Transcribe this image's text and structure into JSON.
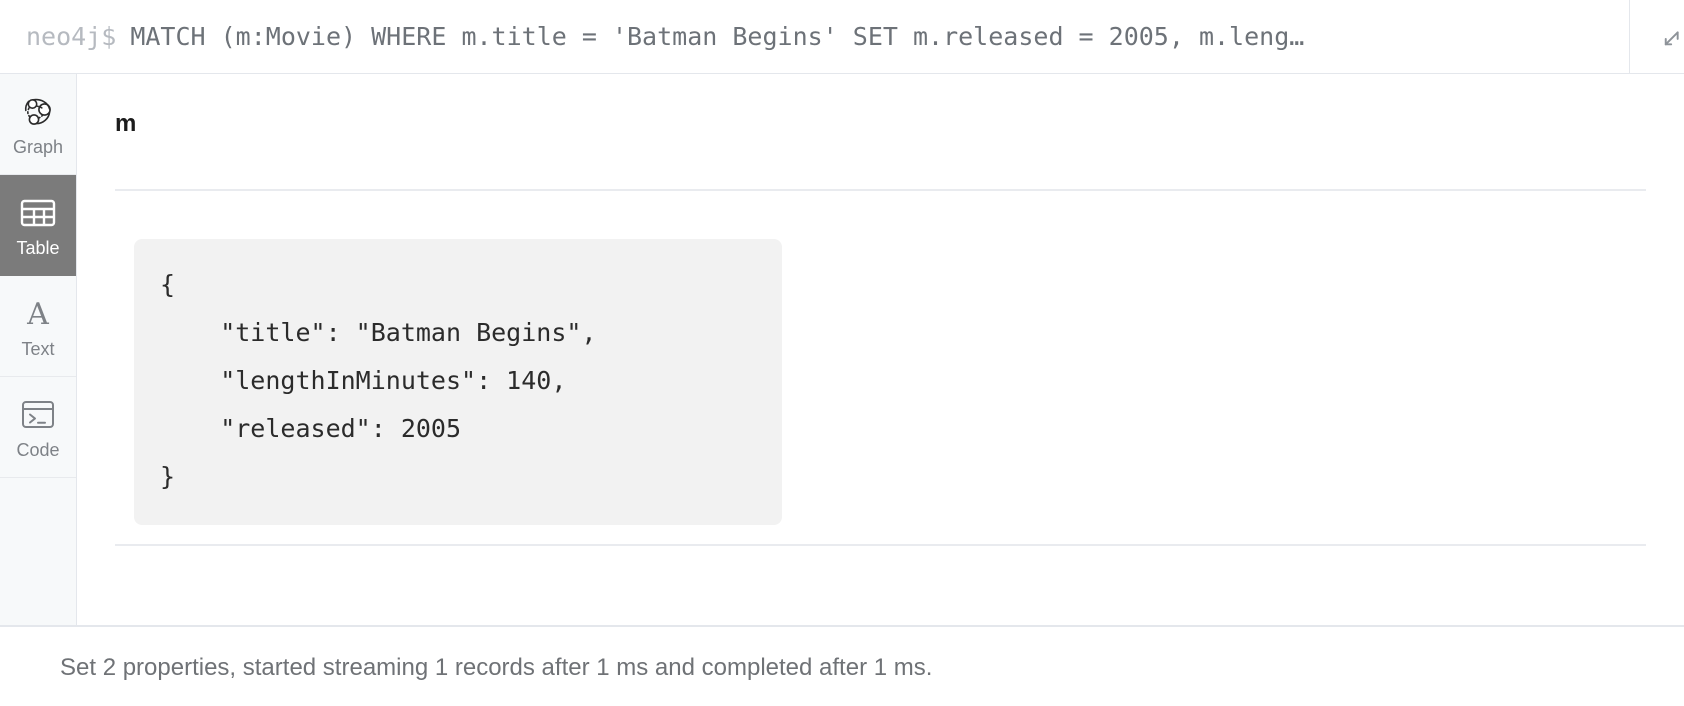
{
  "query_bar": {
    "prompt": "neo4j$",
    "query": "MATCH (m:Movie) WHERE m.title = 'Batman Begins' SET m.released = 2005, m.leng…",
    "pin_icon": "pin-arrow-icon"
  },
  "sidebar": {
    "items": [
      {
        "label": "Graph",
        "icon": "graph-icon",
        "active": false
      },
      {
        "label": "Table",
        "icon": "table-icon",
        "active": true
      },
      {
        "label": "Text",
        "icon": "text-a-icon",
        "active": false
      },
      {
        "label": "Code",
        "icon": "code-terminal-icon",
        "active": false
      }
    ]
  },
  "result": {
    "column_header": "m",
    "json_lines": [
      "{",
      "    \"title\": \"Batman Begins\",",
      "    \"lengthInMinutes\": 140,",
      "    \"released\": 2005",
      "}"
    ]
  },
  "status": {
    "message": "Set 2 properties, started streaming 1 records after 1 ms and completed after 1 ms."
  },
  "colors": {
    "active_tab_bg": "#7b7b7b",
    "sidebar_bg": "#f7f9fa",
    "json_card_bg": "#f2f2f2",
    "border": "#e4e7ec",
    "query_text": "#6d7278",
    "prompt_text": "#b6bac0"
  }
}
